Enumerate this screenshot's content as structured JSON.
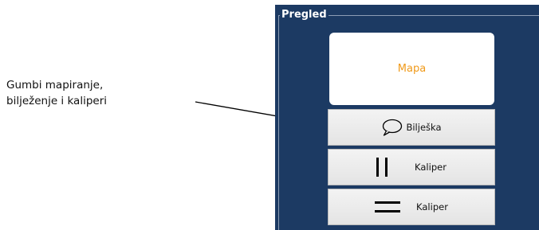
{
  "callout": {
    "line1": "Gumbi mapiranje,",
    "line2": "bilježenje i kaliperi"
  },
  "panel": {
    "title": "Pregled",
    "map_button_label": "Mapa",
    "note_button_label": "Bilješka",
    "caliper_vertical_label": "Kaliper",
    "caliper_horizontal_label": "Kaliper"
  },
  "icons": {
    "note": "speech-bubble-icon",
    "caliper_vertical": "vertical-caliper-icon",
    "caliper_horizontal": "horizontal-caliper-icon"
  },
  "colors": {
    "panel_background": "#1c3a63",
    "map_label": "#f09a1a",
    "button_face": "#ececec"
  }
}
